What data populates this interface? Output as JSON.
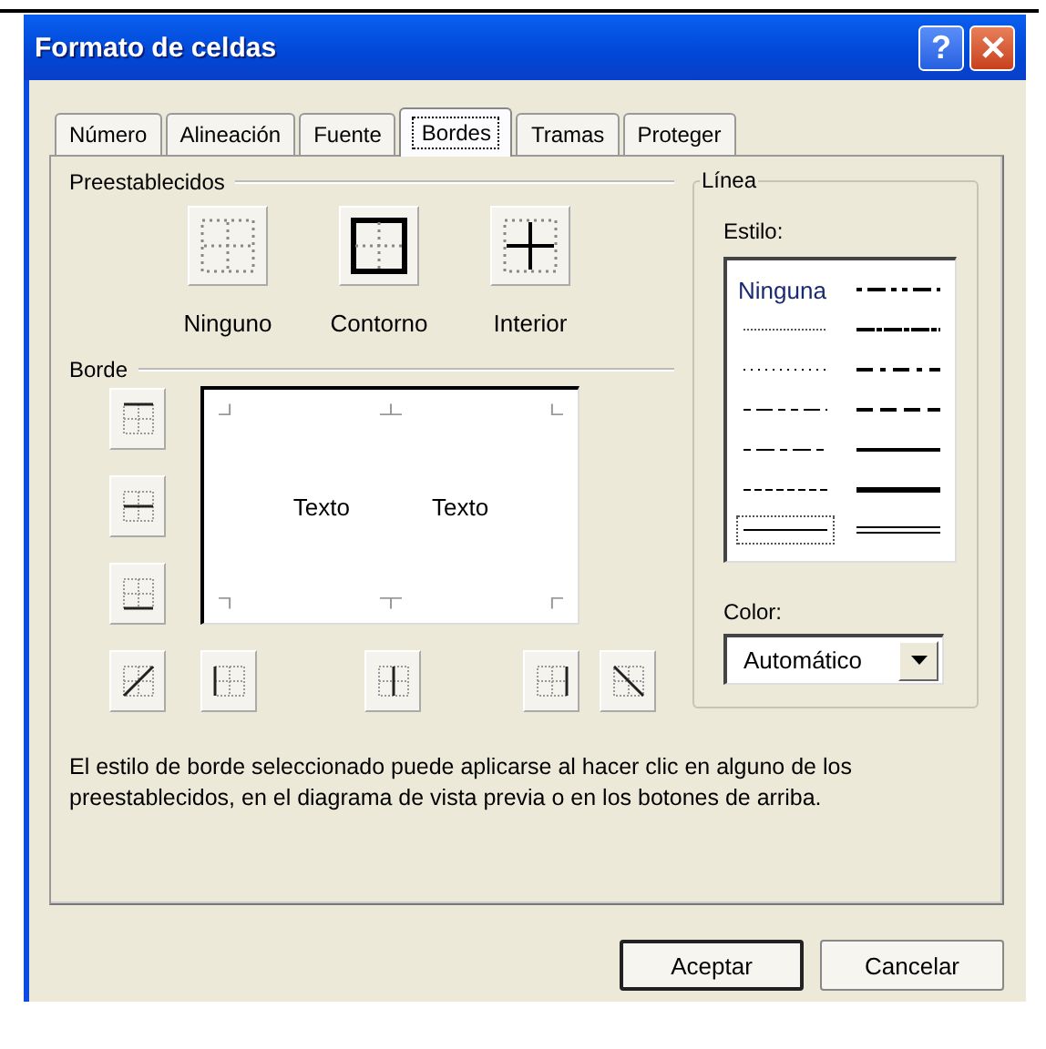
{
  "window": {
    "title": "Formato de celdas",
    "help_button": "?"
  },
  "tabs": [
    {
      "label": "Número",
      "selected": false
    },
    {
      "label": "Alineación",
      "selected": false
    },
    {
      "label": "Fuente",
      "selected": false
    },
    {
      "label": "Bordes",
      "selected": true
    },
    {
      "label": "Tramas",
      "selected": false
    },
    {
      "label": "Proteger",
      "selected": false
    }
  ],
  "presets": {
    "heading": "Preestablecidos",
    "items": [
      {
        "label": "Ninguno"
      },
      {
        "label": "Contorno"
      },
      {
        "label": "Interior"
      }
    ]
  },
  "border": {
    "heading": "Borde",
    "preview_texts": [
      "Texto",
      "Texto"
    ]
  },
  "line": {
    "heading": "Línea",
    "style_label": "Estilo:",
    "color_label": "Color:",
    "color_value": "Automático",
    "styles": [
      {
        "label": "Ninguna",
        "selected": false
      },
      {
        "selected": false
      },
      {
        "selected": false
      },
      {
        "selected": false
      },
      {
        "selected": false
      },
      {
        "selected": false
      },
      {
        "selected": false
      },
      {
        "selected": false
      },
      {
        "selected": false
      },
      {
        "selected": false
      },
      {
        "selected": false
      },
      {
        "selected": false
      },
      {
        "selected": true
      },
      {
        "selected": false
      }
    ]
  },
  "description": "El estilo de borde seleccionado puede aplicarse al hacer clic en alguno de los preestablecidos, en el diagrama de vista previa o en los botones de arriba.",
  "buttons": [
    {
      "label": "Aceptar",
      "default": true
    },
    {
      "label": "Cancelar",
      "default": false
    }
  ]
}
